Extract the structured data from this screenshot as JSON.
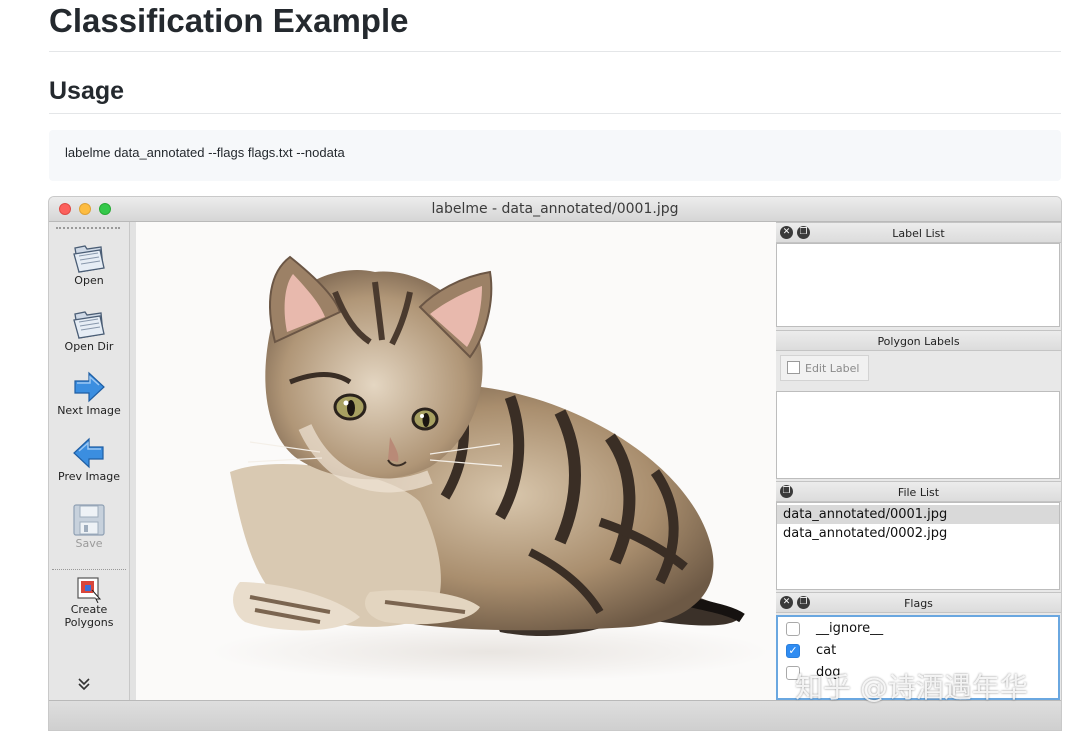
{
  "doc": {
    "title": "Classification Example",
    "section": "Usage",
    "command": "labelme data_annotated --flags flags.txt --nodata"
  },
  "window": {
    "title": "labelme - data_annotated/0001.jpg"
  },
  "toolbar": {
    "items": [
      {
        "label": "Open",
        "icon": "folder-open-icon",
        "enabled": true
      },
      {
        "label": "Open Dir",
        "icon": "folder-open-icon",
        "enabled": true
      },
      {
        "label": "Next Image",
        "icon": "arrow-right-icon",
        "enabled": true
      },
      {
        "label": "Prev Image",
        "icon": "arrow-left-icon",
        "enabled": true
      },
      {
        "label": "Save",
        "icon": "floppy-disk-icon",
        "enabled": false
      },
      {
        "label": "Create\nPolygons",
        "icon": "create-polygon-icon",
        "enabled": true
      }
    ],
    "more": "»"
  },
  "canvas": {
    "image_subject": "tabby kitten"
  },
  "panels": {
    "label_list": {
      "title": "Label List"
    },
    "polygon_labels": {
      "title": "Polygon Labels",
      "edit_button": "Edit Label"
    },
    "file_list": {
      "title": "File List",
      "files": [
        "data_annotated/0001.jpg",
        "data_annotated/0002.jpg"
      ],
      "selected_index": 0
    },
    "flags": {
      "title": "Flags",
      "items": [
        {
          "label": "__ignore__",
          "checked": false
        },
        {
          "label": "cat",
          "checked": true
        },
        {
          "label": "dog",
          "checked": false
        }
      ]
    }
  },
  "watermark": "知乎 @诗酒遇年华",
  "colors": {
    "accent": "#2f8cf2",
    "flags_border": "#6aa7e0",
    "arrow_blue": "#3b8ee0"
  }
}
